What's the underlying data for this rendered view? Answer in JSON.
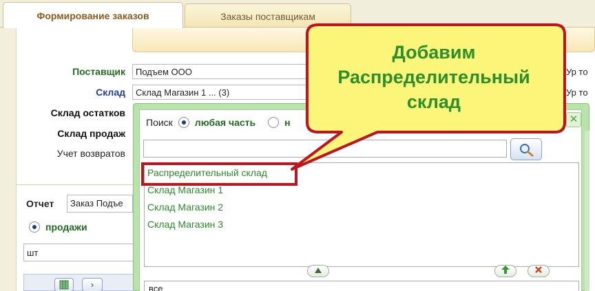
{
  "tabs": [
    {
      "label": "Формирование заказов",
      "active": true
    },
    {
      "label": "Заказы поставщикам",
      "active": false
    }
  ],
  "form": {
    "supplier_label": "Поставщик",
    "supplier_value": "Подъем ООО",
    "warehouse_label": "Склад",
    "warehouse_value": "Склад Магазин 1 ... (3)",
    "stock_warehouse_label": "Склад остатков",
    "sales_warehouse_label": "Склад продаж",
    "returns_label": "Учет возвратов",
    "right_text_1": "Ур то",
    "right_text_2": "Ур то"
  },
  "report": {
    "label": "Отчет",
    "value": "Заказ Подъе",
    "sales_option": "продажи",
    "unit_value": "шт"
  },
  "popup": {
    "search_label": "Поиск",
    "option_any_part": "любая часть",
    "option_second_partial": "н",
    "search_value": "",
    "list_items": [
      "Распределительный склад",
      "Склад Магазин 1",
      "Склад Магазин 2",
      "Склад Магазин 3"
    ],
    "all_field_value": "все",
    "close_glyph": "✕"
  },
  "callout": {
    "line1": "Добавим",
    "line2": "Распределительный",
    "line3": "склад",
    "fill_color": "#fbf57a",
    "border_color": "#c1121f",
    "text_color": "#2b8f2b"
  },
  "colors": {
    "label_green": "#1f6b1f",
    "label_blue": "#1f3f9a",
    "list_green": "#2b8a2b",
    "popup_green": "#b7e4a8"
  },
  "icons": [
    "magnifier-icon",
    "up-arrow-icon",
    "delete-icon",
    "triangle-up-icon",
    "close-icon",
    "grid-icon"
  ]
}
